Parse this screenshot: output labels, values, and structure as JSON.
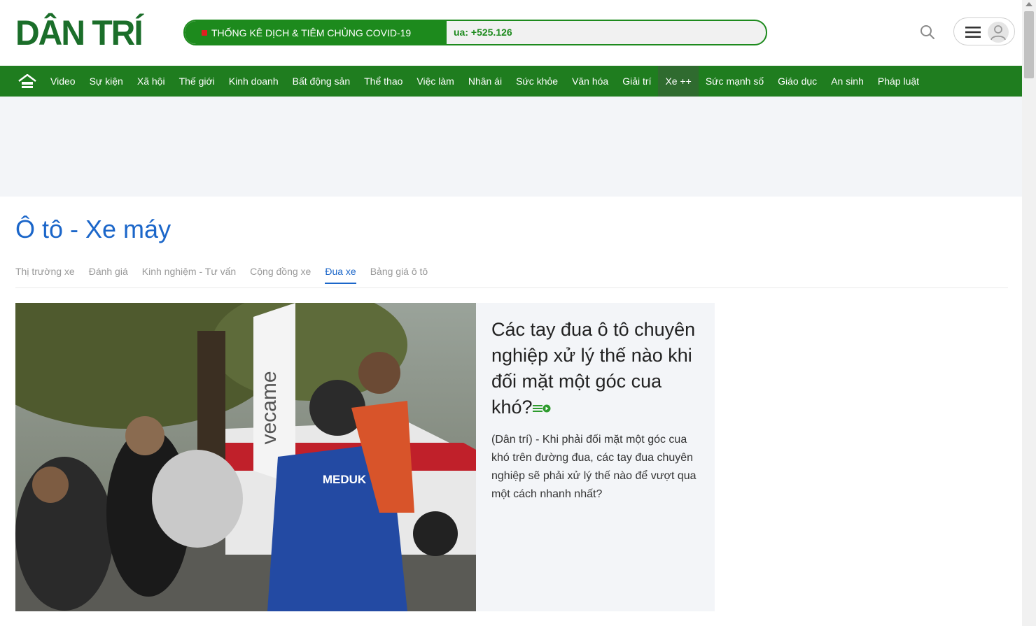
{
  "header": {
    "logo_text": "DÂN TRÍ",
    "covid_title": "THỐNG KÊ DỊCH & TIÊM CHỦNG COVID-19",
    "covid_count": "ua: +525.126",
    "search_icon": "search-icon",
    "menu_icon": "hamburger-icon",
    "avatar_icon": "user-avatar-icon"
  },
  "nav": {
    "home_icon": "home-icon",
    "items": [
      "Video",
      "Sự kiện",
      "Xã hội",
      "Thế giới",
      "Kinh doanh",
      "Bất động sản",
      "Thể thao",
      "Việc làm",
      "Nhân ái",
      "Sức khỏe",
      "Văn hóa",
      "Giải trí",
      "Xe ++",
      "Sức mạnh số",
      "Giáo dục",
      "An sinh",
      "Pháp luật"
    ],
    "active": "Xe ++"
  },
  "category": {
    "title": "Ô tô - Xe máy",
    "subnav": [
      "Thị trường xe",
      "Đánh giá",
      "Kinh nghiệm - Tư vấn",
      "Cộng đồng xe",
      "Đua xe",
      "Bảng giá ô tô"
    ],
    "active_subnav": "Đua xe"
  },
  "featured": {
    "headline": "Các tay đua ô tô chuyên nghiệp xử lý thế nào khi đối mặt một góc cua khó?",
    "sapo": "(Dân trí) - Khi phải đối mặt một góc cua khó trên đường đua, các tay đua chuyên nghiệp sẽ phải xử lý thế nào để vượt qua một cách nhanh nhất?",
    "photo_banner_text": "vecame",
    "photo_jacket_text": "MEDUK",
    "video_icon": "video-badge-icon"
  },
  "colors": {
    "brand_green": "#1f7d1f",
    "category_blue": "#1b66c9",
    "panel_bg": "#f3f5f8"
  }
}
